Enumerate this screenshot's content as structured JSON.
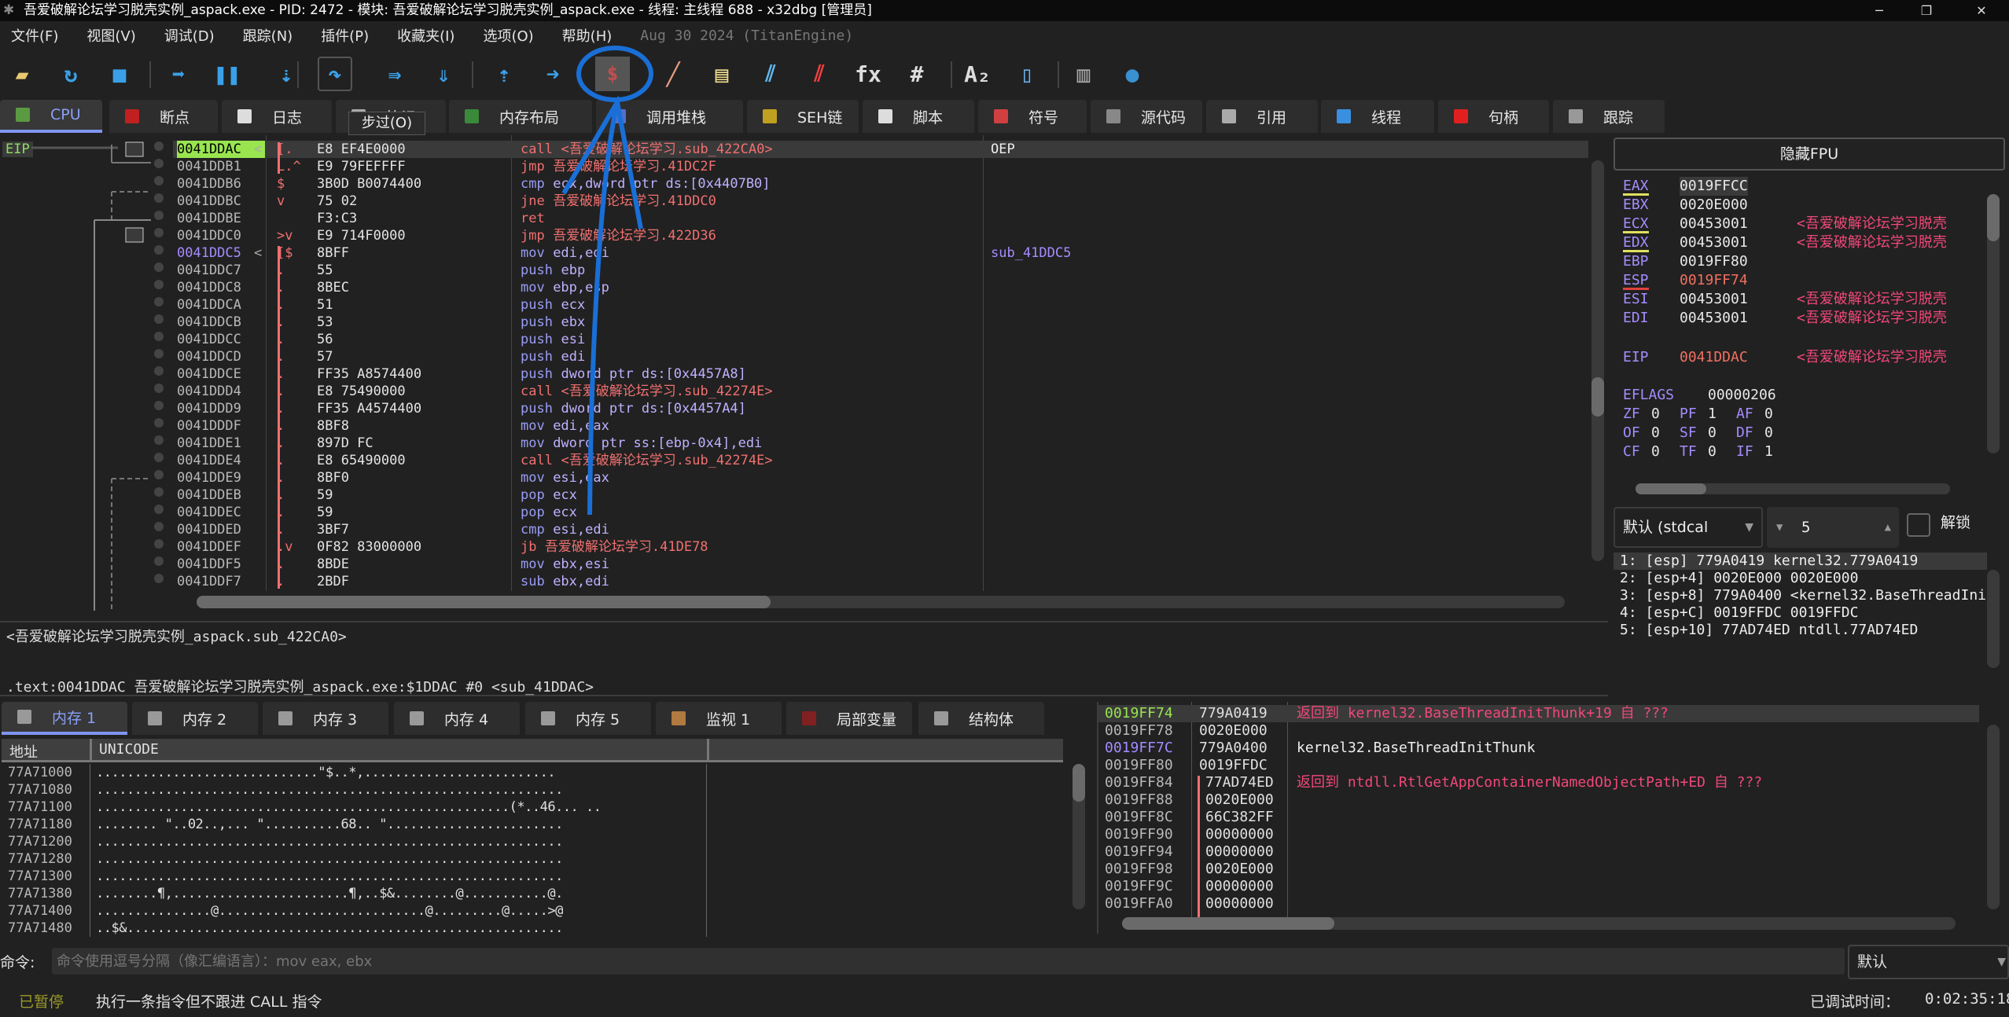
{
  "window": {
    "title": "吾爱破解论坛学习脱壳实例_aspack.exe - PID: 2472 - 模块: 吾爱破解论坛学习脱壳实例_aspack.exe - 线程: 主线程 688 - x32dbg [管理员]",
    "minimize": "─",
    "maximize": "❐",
    "close": "✕"
  },
  "menu": {
    "items": [
      "文件(F)",
      "视图(V)",
      "调试(D)",
      "跟踪(N)",
      "插件(P)",
      "收藏夹(I)",
      "选项(O)",
      "帮助(H)"
    ],
    "version": "Aug 30 2024 (TitanEngine)"
  },
  "toolbar": {
    "icons": [
      {
        "name": "open-folder-icon",
        "glyph": "▰",
        "color": "#e8c870"
      },
      {
        "name": "restart-icon",
        "glyph": "↻",
        "color": "#3aa0e8"
      },
      {
        "name": "stop-icon",
        "glyph": "■",
        "color": "#3aa0e8"
      },
      {
        "name": "run-icon",
        "glyph": "➡",
        "color": "#3aa0e8"
      },
      {
        "name": "pause-icon",
        "glyph": "❚❚",
        "color": "#3aa0e8"
      },
      {
        "name": "step-into-icon",
        "glyph": "⇣",
        "color": "#3aa0e8"
      },
      {
        "name": "step-over-icon",
        "glyph": "↷",
        "color": "#3aa0e8"
      },
      {
        "name": "trace-into-icon",
        "glyph": "⇛",
        "color": "#3aa0e8"
      },
      {
        "name": "trace-over-icon",
        "glyph": "⇓",
        "color": "#3aa0e8"
      },
      {
        "name": "execute-till-return-icon",
        "glyph": "⇡",
        "color": "#3aa0e8"
      },
      {
        "name": "run-to-user-code-icon",
        "glyph": "➜",
        "color": "#3aa0e8"
      },
      {
        "name": "scylla-dump-icon",
        "glyph": "$",
        "color": "#c05050"
      },
      {
        "name": "patch-icon",
        "glyph": "╱",
        "color": "#e8a080"
      },
      {
        "name": "comments-icon",
        "glyph": "▤",
        "color": "#f0e090"
      },
      {
        "name": "labels-icon",
        "glyph": "⫽",
        "color": "#60b8f0"
      },
      {
        "name": "bookmarks-icon",
        "glyph": "⫽",
        "color": "#f04040"
      },
      {
        "name": "functions-icon",
        "glyph": "fx",
        "color": "#dddddd"
      },
      {
        "name": "hash-icon",
        "glyph": "#",
        "color": "#dddddd"
      },
      {
        "name": "font-icon",
        "glyph": "A₂",
        "color": "#dddddd"
      },
      {
        "name": "memory-map-icon",
        "glyph": "▯",
        "color": "#6ab0f0"
      },
      {
        "name": "calculator-icon",
        "glyph": "▥",
        "color": "#aaaaaa"
      },
      {
        "name": "globe-icon",
        "glyph": "●",
        "color": "#3a90d0"
      }
    ],
    "tooltip": "步过(O)"
  },
  "tabs": [
    {
      "label": "CPU",
      "icon": "cpu-icon",
      "color": "#5a9a40",
      "active": true
    },
    {
      "label": "断点",
      "icon": "breakpoint-icon",
      "color": "#c02020"
    },
    {
      "label": "日志",
      "icon": "log-icon",
      "color": "#dddddd"
    },
    {
      "label": "笔记",
      "icon": "notes-icon",
      "color": "#aaaaaa"
    },
    {
      "label": "内存布局",
      "icon": "memory-map-icon",
      "color": "#3a8a3a"
    },
    {
      "label": "调用堆栈",
      "icon": "callstack-icon",
      "color": "#5070d0"
    },
    {
      "label": "SEH链",
      "icon": "seh-icon",
      "color": "#c0a020"
    },
    {
      "label": "脚本",
      "icon": "script-icon",
      "color": "#dddddd"
    },
    {
      "label": "符号",
      "icon": "symbols-icon",
      "color": "#d04040"
    },
    {
      "label": "源代码",
      "icon": "source-icon",
      "color": "#888888"
    },
    {
      "label": "引用",
      "icon": "references-icon",
      "color": "#aaaaaa"
    },
    {
      "label": "线程",
      "icon": "threads-icon",
      "color": "#3a90e0"
    },
    {
      "label": "句柄",
      "icon": "handles-icon",
      "color": "#e02020"
    },
    {
      "label": "跟踪",
      "icon": "trace-icon",
      "color": "#999999"
    }
  ],
  "cpu": {
    "eip_label": "EIP",
    "rows": [
      {
        "addr": "0041DDAC",
        "arrow": "<",
        "mark": "[.",
        "bytes": "E8 EF4E0000",
        "mn": "call",
        "ops": "<吾爱破解论坛学习.sub_422CA0>",
        "cmt": "OEP",
        "cur": true
      },
      {
        "addr": "0041DDB1",
        "mark": "L.^",
        "bytes": "E9 79FEFFFF",
        "mn": "jmp",
        "ops": "吾爱破解论坛学习.41DC2F"
      },
      {
        "addr": "0041DDB6",
        "mark": " $",
        "bytes": "3B0D B0074400",
        "mn": "cmp",
        "ops": "ecx,dword ptr ds:[0x4407B0]"
      },
      {
        "addr": "0041DDBC",
        "mark": "  v",
        "bytes": "75 02",
        "mn": "jne",
        "ops": "吾爱破解论坛学习.41DDC0"
      },
      {
        "addr": "0041DDBE",
        "mark": "",
        "bytes": "F3:C3",
        "mn": "ret",
        "ops": ""
      },
      {
        "addr": "0041DDC0",
        "mark": " >v",
        "bytes": "E9 714F0000",
        "mn": "jmp",
        "ops": "吾爱破解论坛学习.422D36"
      },
      {
        "addr": "0041DDC5",
        "arrow": "<",
        "mark": "[$",
        "bytes": "8BFF",
        "mn": "mov",
        "ops": "edi,edi",
        "cmt": "sub_41DDC5",
        "label": true
      },
      {
        "addr": "0041DDC7",
        "mark": " .",
        "bytes": "55",
        "mn": "push",
        "ops": "ebp"
      },
      {
        "addr": "0041DDC8",
        "mark": " .",
        "bytes": "8BEC",
        "mn": "mov",
        "ops": "ebp,esp"
      },
      {
        "addr": "0041DDCA",
        "mark": " .",
        "bytes": "51",
        "mn": "push",
        "ops": "ecx"
      },
      {
        "addr": "0041DDCB",
        "mark": " .",
        "bytes": "53",
        "mn": "push",
        "ops": "ebx"
      },
      {
        "addr": "0041DDCC",
        "mark": " .",
        "bytes": "56",
        "mn": "push",
        "ops": "esi"
      },
      {
        "addr": "0041DDCD",
        "mark": " .",
        "bytes": "57",
        "mn": "push",
        "ops": "edi"
      },
      {
        "addr": "0041DDCE",
        "mark": " .",
        "bytes": "FF35 A8574400",
        "mn": "push",
        "ops": "dword ptr ds:[0x4457A8]"
      },
      {
        "addr": "0041DDD4",
        "mark": " .",
        "bytes": "E8 75490000",
        "mn": "call",
        "ops": "<吾爱破解论坛学习.sub_42274E>"
      },
      {
        "addr": "0041DDD9",
        "mark": " .",
        "bytes": "FF35 A4574400",
        "mn": "push",
        "ops": "dword ptr ds:[0x4457A4]"
      },
      {
        "addr": "0041DDDF",
        "mark": " .",
        "bytes": "8BF8",
        "mn": "mov",
        "ops": "edi,eax"
      },
      {
        "addr": "0041DDE1",
        "mark": " .",
        "bytes": "897D FC",
        "mn": "mov",
        "ops": "dword ptr ss:[ebp-0x4],edi"
      },
      {
        "addr": "0041DDE4",
        "mark": " .",
        "bytes": "E8 65490000",
        "mn": "call",
        "ops": "<吾爱破解论坛学习.sub_42274E>"
      },
      {
        "addr": "0041DDE9",
        "mark": " .",
        "bytes": "8BF0",
        "mn": "mov",
        "ops": "esi,eax"
      },
      {
        "addr": "0041DDEB",
        "mark": " .",
        "bytes": "59",
        "mn": "pop",
        "ops": "ecx"
      },
      {
        "addr": "0041DDEC",
        "mark": " .",
        "bytes": "59",
        "mn": "pop",
        "ops": "ecx"
      },
      {
        "addr": "0041DDED",
        "mark": " .",
        "bytes": "3BF7",
        "mn": "cmp",
        "ops": "esi,edi"
      },
      {
        "addr": "0041DDEF",
        "mark": " .v",
        "bytes": "0F82 83000000",
        "mn": "jb",
        "ops": "吾爱破解论坛学习.41DE78"
      },
      {
        "addr": "0041DDF5",
        "mark": " .",
        "bytes": "8BDE",
        "mn": "mov",
        "ops": "ebx,esi"
      },
      {
        "addr": "0041DDF7",
        "mark": " .",
        "bytes": "2BDF",
        "mn": "sub",
        "ops": "ebx,edi"
      }
    ]
  },
  "info": {
    "line1": "<吾爱破解论坛学习脱壳实例_aspack.sub_422CA0>",
    "line2": ".text:0041DDAC 吾爱破解论坛学习脱壳实例_aspack.exe:$1DDAC #0 <sub_41DDAC>"
  },
  "registers": {
    "fpu_button": "隐藏FPU",
    "regs": [
      {
        "name": "EAX",
        "val": "0019FFCC",
        "cmt": "",
        "ul": "y",
        "hl": true
      },
      {
        "name": "EBX",
        "val": "0020E000",
        "cmt": ""
      },
      {
        "name": "ECX",
        "val": "00453001",
        "cmt": "<吾爱破解论坛学习脱壳",
        "ul": "y"
      },
      {
        "name": "EDX",
        "val": "00453001",
        "cmt": "<吾爱破解论坛学习脱壳",
        "ul": "y"
      },
      {
        "name": "EBP",
        "val": "0019FF80",
        "cmt": ""
      },
      {
        "name": "ESP",
        "val": "0019FF74",
        "cmt": "",
        "ul": "r",
        "red": true
      },
      {
        "name": "ESI",
        "val": "00453001",
        "cmt": "<吾爱破解论坛学习脱壳"
      },
      {
        "name": "EDI",
        "val": "00453001",
        "cmt": "<吾爱破解论坛学习脱壳"
      }
    ],
    "eip": {
      "name": "EIP",
      "val": "0041DDAC",
      "cmt": "<吾爱破解论坛学习脱壳"
    },
    "eflags": {
      "name": "EFLAGS",
      "val": "00000206"
    },
    "flags": [
      [
        "ZF",
        "0"
      ],
      [
        "PF",
        "1"
      ],
      [
        "AF",
        "0"
      ],
      [
        "OF",
        "0"
      ],
      [
        "SF",
        "0"
      ],
      [
        "DF",
        "0"
      ],
      [
        "CF",
        "0"
      ],
      [
        "TF",
        "0"
      ],
      [
        "IF",
        "1"
      ]
    ]
  },
  "args": {
    "callconv": "默认 (stdcal",
    "count": "5",
    "unlock_label": "解锁",
    "items": [
      "1: [esp] 779A0419 kernel32.779A0419",
      "2: [esp+4] 0020E000 0020E000",
      "3: [esp+8] 779A0400 <kernel32.BaseThreadInitThunk>",
      "4: [esp+C] 0019FFDC 0019FFDC",
      "5: [esp+10] 77AD74ED ntdll.77AD74ED"
    ]
  },
  "bottom_tabs": [
    {
      "label": "内存 1",
      "icon": "memory-icon",
      "active": true
    },
    {
      "label": "内存 2",
      "icon": "memory-icon"
    },
    {
      "label": "内存 3",
      "icon": "memory-icon"
    },
    {
      "label": "内存 4",
      "icon": "memory-icon"
    },
    {
      "label": "内存 5",
      "icon": "memory-icon"
    },
    {
      "label": "监视 1",
      "icon": "watch-icon"
    },
    {
      "label": "局部变量",
      "icon": "locals-icon"
    },
    {
      "label": "结构体",
      "icon": "struct-icon"
    }
  ],
  "dump": {
    "col_addr": "地址",
    "col_data": "UNICODE",
    "rows": [
      [
        "77A71000",
        ".............................\"$..*,........................."
      ],
      [
        "77A71080",
        "............................................................."
      ],
      [
        "77A71100",
        "......................................................(*..46... .."
      ],
      [
        "77A71180",
        "........ \"..02..,...  \"..........68..  \"......................."
      ],
      [
        "77A71200",
        "............................................................."
      ],
      [
        "77A71280",
        "............................................................."
      ],
      [
        "77A71300",
        "............................................................."
      ],
      [
        "77A71380",
        "........¶,.......................¶,..$&........@...........@."
      ],
      [
        "77A71400",
        "...............@...........................@.........@.....>@"
      ],
      [
        "77A71480",
        "..$&........................................................."
      ]
    ]
  },
  "stack": {
    "rows": [
      {
        "addr": "0019FF74",
        "val": "779A0419",
        "cmt": "返回到 kernel32.BaseThreadInitThunk+19 自 ???",
        "cur": true,
        "ret": true
      },
      {
        "addr": "0019FF78",
        "val": "0020E000",
        "cmt": ""
      },
      {
        "addr": "0019FF7C",
        "val": "779A0400",
        "cmt": "kernel32.BaseThreadInitThunk",
        "label": true
      },
      {
        "addr": "0019FF80",
        "val": "0019FFDC",
        "cmt": ""
      },
      {
        "addr": "0019FF84",
        "val": "77AD74ED",
        "cmt": "返回到 ntdll.RtlGetAppContainerNamedObjectPath+ED 自 ???",
        "ret": true
      },
      {
        "addr": "0019FF88",
        "val": "0020E000",
        "cmt": ""
      },
      {
        "addr": "0019FF8C",
        "val": "66C382FF",
        "cmt": ""
      },
      {
        "addr": "0019FF90",
        "val": "00000000",
        "cmt": ""
      },
      {
        "addr": "0019FF94",
        "val": "00000000",
        "cmt": ""
      },
      {
        "addr": "0019FF98",
        "val": "0020E000",
        "cmt": ""
      },
      {
        "addr": "0019FF9C",
        "val": "00000000",
        "cmt": ""
      },
      {
        "addr": "0019FFA0",
        "val": "00000000",
        "cmt": ""
      }
    ]
  },
  "command": {
    "label": "命令:",
    "placeholder": "命令使用逗号分隔（像汇编语言）：mov eax, ebx",
    "mode": "默认"
  },
  "status": {
    "state": "已暂停",
    "message": "执行一条指令但不跟进 CALL 指令",
    "time_label": "已调试时间：",
    "time": "0:02:35:18",
    "state_color": "#9a9a2a"
  },
  "annotation": {
    "color": "#1a6fd6"
  }
}
